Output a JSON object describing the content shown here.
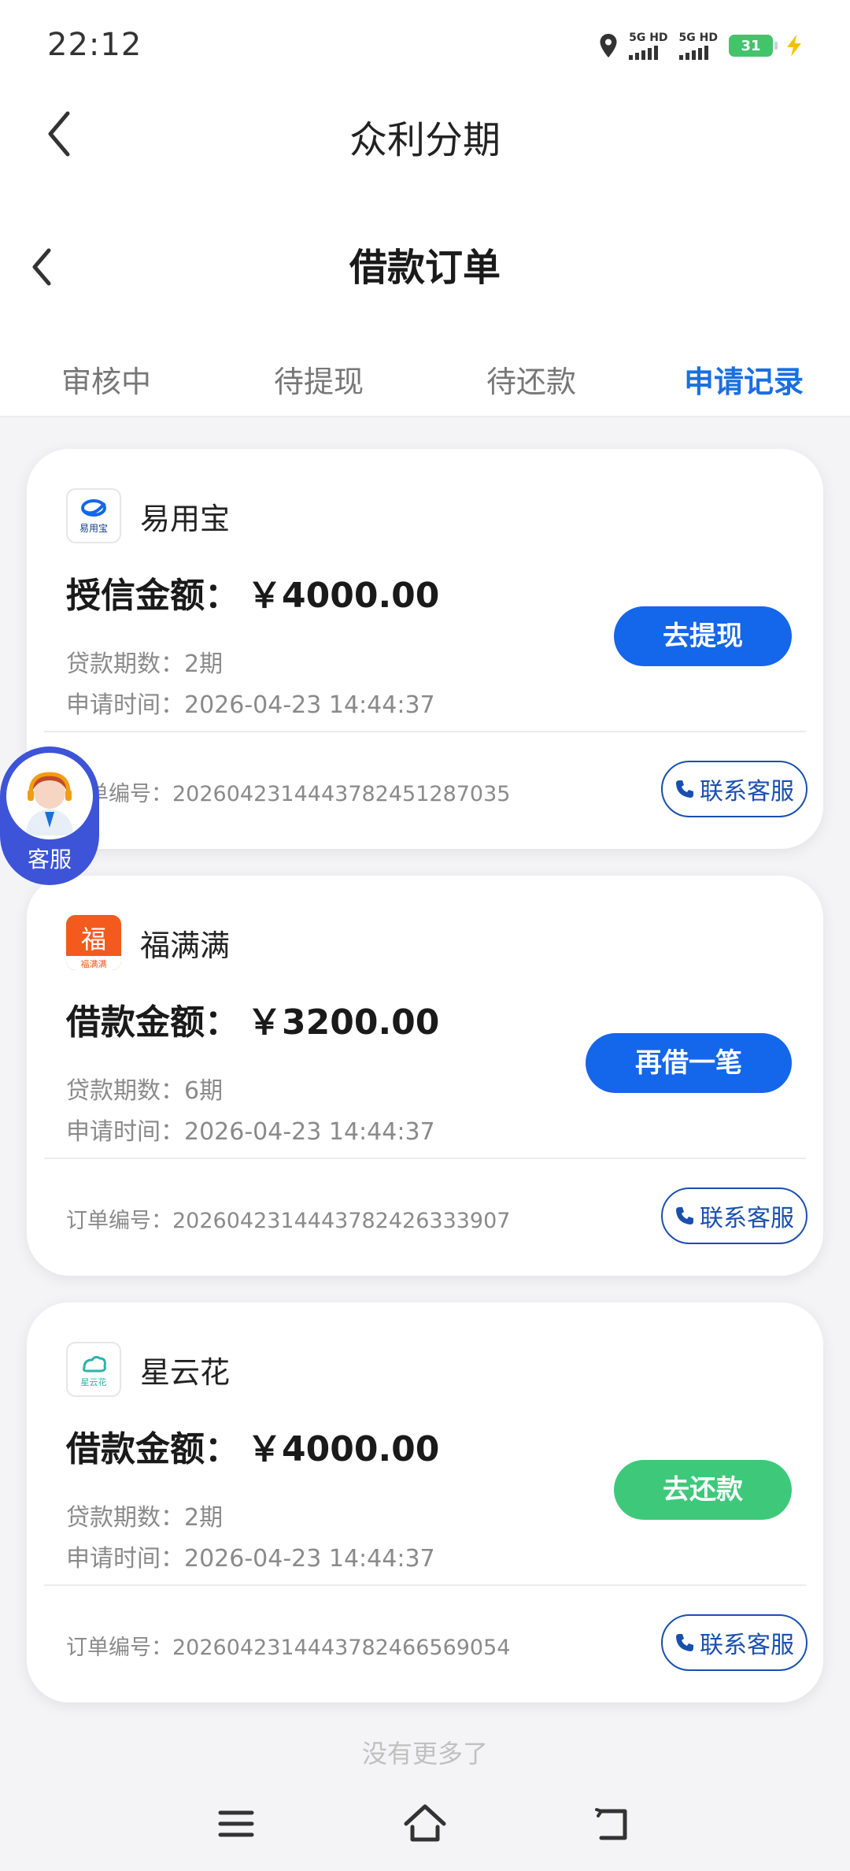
{
  "status_bar": {
    "time": "22:12",
    "sim1_label": "5G HD",
    "sim2_label": "5G HD",
    "battery": "31"
  },
  "app_header": {
    "title": "众利分期"
  },
  "page_header": {
    "title": "借款订单"
  },
  "tabs": [
    {
      "label": "审核中",
      "active": false
    },
    {
      "label": "待提现",
      "active": false
    },
    {
      "label": "待还款",
      "active": false
    },
    {
      "label": "申请记录",
      "active": true
    }
  ],
  "orders": [
    {
      "lender": "易用宝",
      "amount_label": "授信金额：",
      "amount": "￥4000.00",
      "periods": "贷款期数：2期",
      "apply_time": "申请时间：2026-04-23 14:44:37",
      "action": "去提现",
      "action_color": "#1466ea",
      "order_no": "订单编号：20260423144437824512870​35",
      "contact": "联系客服"
    },
    {
      "lender": "福满满",
      "amount_label": "借款金额：",
      "amount": "￥3200.00",
      "periods": "贷款期数：6期",
      "apply_time": "申请时间：2026-04-23 14:44:37",
      "action": "再借一笔",
      "action_color": "#1466ea",
      "order_no": "订单编号：2026042314443782426333907",
      "contact": "联系客服"
    },
    {
      "lender": "星云花",
      "amount_label": "借款金额：",
      "amount": "￥4000.00",
      "periods": "贷款期数：2期",
      "apply_time": "申请时间：2026-04-23 14:44:37",
      "action": "去还款",
      "action_color": "#3ec97a",
      "order_no": "订单编号：2026042314443782466569054",
      "contact": "联系客服"
    }
  ],
  "logo_text": {
    "yiyongbao": "易用宝",
    "fumanman_char": "福",
    "fumanman": "福满满",
    "xingyunhua": "星云花"
  },
  "float_service": {
    "label": "客服"
  },
  "footer": {
    "no_more": "没有更多了"
  },
  "colors": {
    "accent": "#1a6fe0",
    "float": "#3d54d8"
  }
}
